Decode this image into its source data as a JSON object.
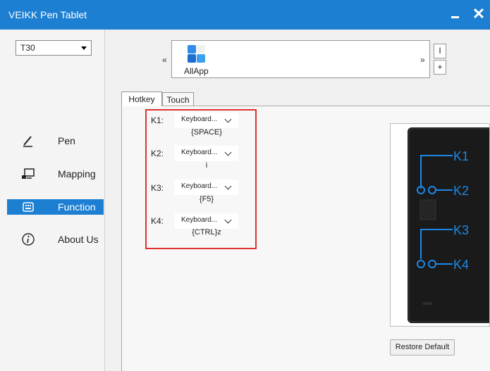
{
  "window": {
    "title": "VEIKK Pen Tablet",
    "minimize_icon": "minimize-icon",
    "close_icon": "close-icon",
    "close_glyph": "✕"
  },
  "sidebar": {
    "device": {
      "value": "T30"
    },
    "items": [
      {
        "label": "Pen",
        "icon": "pen-icon",
        "active": false
      },
      {
        "label": "Mapping",
        "icon": "monitor-icon",
        "active": false
      },
      {
        "label": "Function",
        "icon": "keyboard-icon",
        "active": true
      },
      {
        "label": "About Us",
        "icon": "info-icon",
        "active": false
      }
    ]
  },
  "app_bar": {
    "prev_glyph": "«",
    "next_glyph": "»",
    "apps": [
      {
        "name": "AllApp",
        "icon": "all-apps-icon"
      }
    ],
    "minus_glyph": "I",
    "plus_glyph": "+"
  },
  "tabs": [
    {
      "label": "Hotkey",
      "active": true
    },
    {
      "label": "Touch",
      "active": false
    }
  ],
  "hotkeys": [
    {
      "label": "K1:",
      "action": "Keyboard...",
      "value": "{SPACE}"
    },
    {
      "label": "K2:",
      "action": "Keyboard...",
      "value": "i"
    },
    {
      "label": "K3:",
      "action": "Keyboard...",
      "value": "{F5}"
    },
    {
      "label": "K4:",
      "action": "Keyboard...",
      "value": "{CTRL}z"
    }
  ],
  "tablet_image": {
    "key_labels": [
      "K1",
      "K2",
      "K3",
      "K4"
    ],
    "brand": "VEIKK",
    "accent_color": "#1e88e5"
  },
  "restore_label": "Restore Default",
  "colors": {
    "accent": "#1c7fd2",
    "highlight": "#e03131"
  }
}
